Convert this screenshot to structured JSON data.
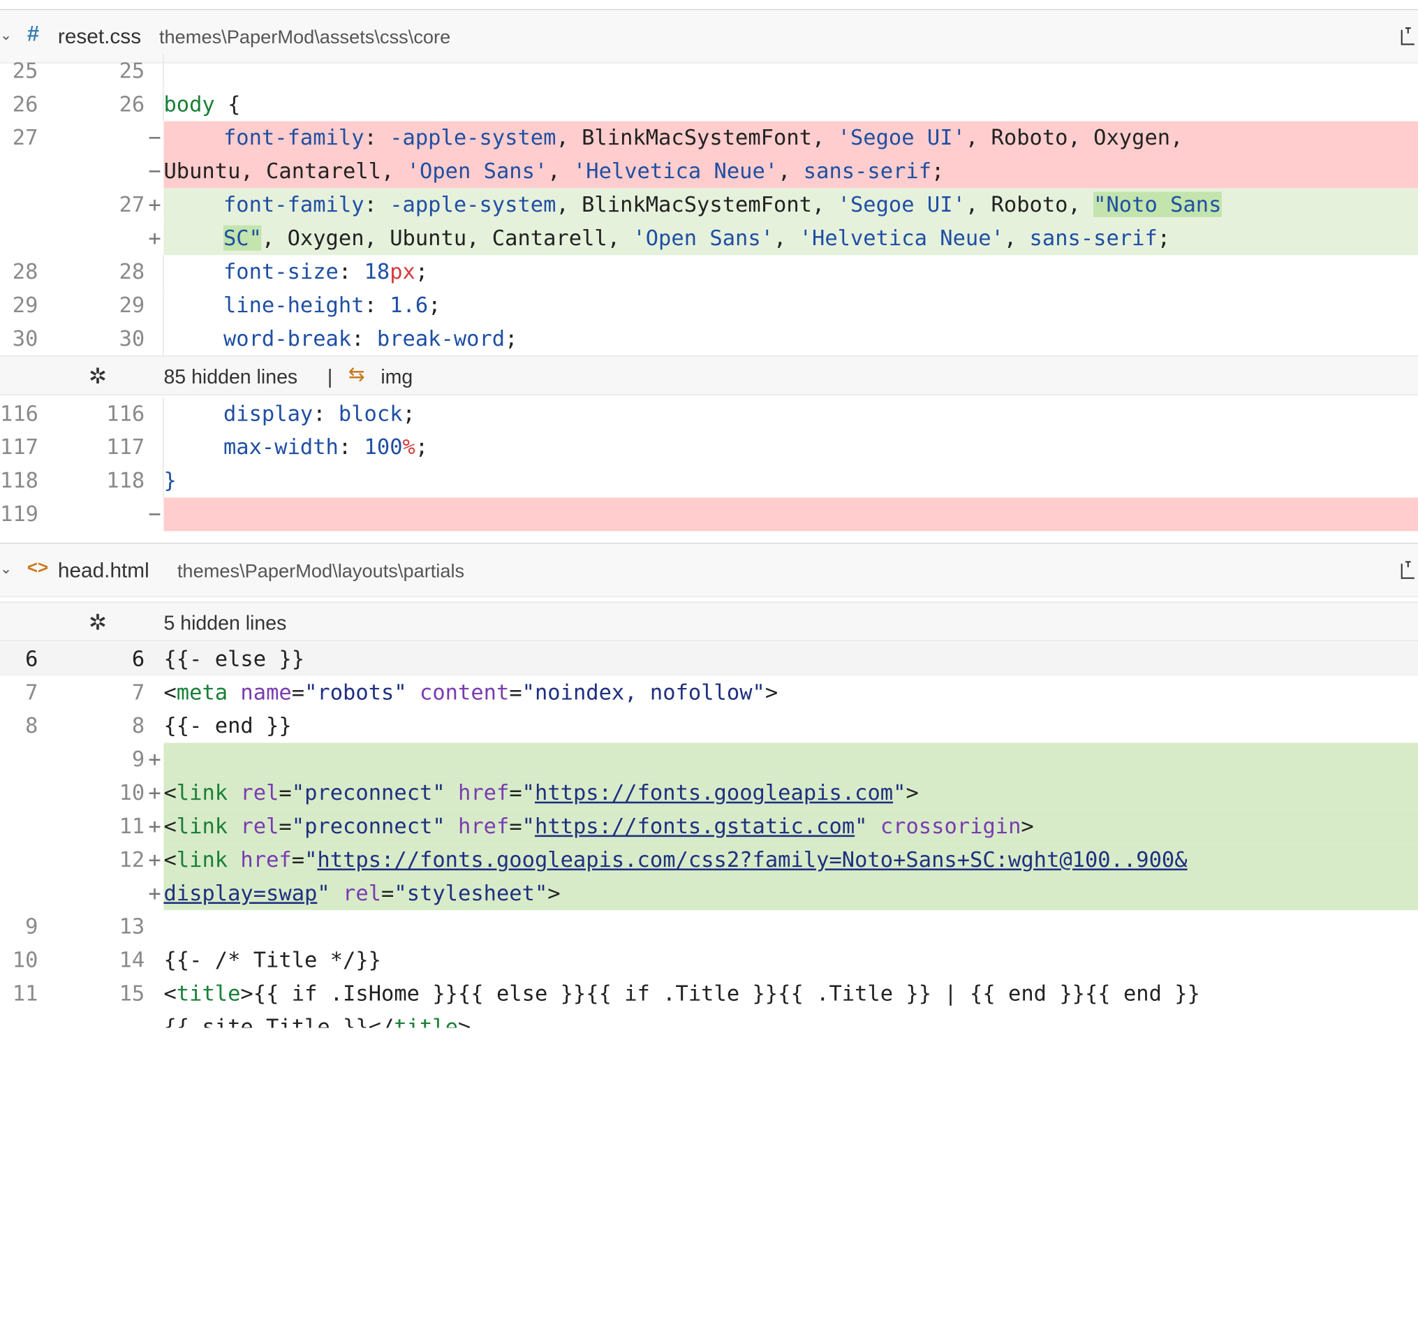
{
  "files": [
    {
      "icon": "#",
      "name": "reset.css",
      "path": "themes\\PaperMod\\assets\\css\\core"
    },
    {
      "icon": "<>",
      "name": "head.html",
      "path": "themes\\PaperMod\\layouts\\partials"
    }
  ],
  "reset": {
    "hidden1": {
      "label": "85 hidden lines",
      "sep": "|",
      "symbol": "img"
    },
    "lines": {
      "l25": {
        "old": "25",
        "new": "25"
      },
      "l26": {
        "old": "26",
        "new": "26"
      },
      "l27": {
        "old": "27",
        "new": "27"
      },
      "l28": {
        "old": "28",
        "new": "28"
      },
      "l29": {
        "old": "29",
        "new": "29"
      },
      "l30": {
        "old": "30",
        "new": "30"
      },
      "l116": {
        "old": "116",
        "new": "116"
      },
      "l117": {
        "old": "117",
        "new": "117"
      },
      "l118": {
        "old": "118",
        "new": "118"
      },
      "l119": {
        "old": "119"
      }
    }
  },
  "head": {
    "hidden": {
      "label": "5 hidden lines"
    },
    "nums": {
      "a": {
        "old": "6",
        "new": "6"
      },
      "b": {
        "old": "7",
        "new": "7"
      },
      "c": {
        "old": "8",
        "new": "8"
      },
      "d": {
        "new": "9"
      },
      "e": {
        "new": "10"
      },
      "f": {
        "new": "11"
      },
      "g": {
        "new": "12"
      },
      "h": {
        "old": "9",
        "new": "13"
      },
      "i": {
        "old": "10",
        "new": "14"
      },
      "j": {
        "old": "11",
        "new": "15"
      }
    }
  },
  "code": {
    "body": "body",
    "ob": " {",
    "ff": "font-family",
    "colon": ": ",
    "apple": "-apple-system",
    "rest1": ", BlinkMacSystemFont, ",
    "segoe": "'Segoe UI'",
    "rest2": ", Roboto, Oxygen,",
    "ubuntu": "Ubuntu, Cantarell, ",
    "opensans": "'Open Sans'",
    "comma": ", ",
    "helv": "'Helvetica Neue'",
    "sans": "sans-serif",
    "semi": ";",
    "roboto": ", Roboto, ",
    "noto1": "\"Noto Sans",
    "noto2": "SC\"",
    "rest3": ", Oxygen, Ubuntu, Cantarell, ",
    "fs": "font-size",
    "n18": "18",
    "px": "px",
    "lh": "line-height",
    "n16": "1.6",
    "wb": "word-break",
    "bw": "break-word",
    "disp": "display",
    "block": "block",
    "mw": "max-width",
    "n100": "100",
    "pct": "%",
    "cb": "}",
    "else": "{{- else }}",
    "lt": "<",
    "gt": ">",
    "meta": "meta",
    "name": "name",
    "eq": "=",
    "robots": "\"robots\"",
    "content": "content",
    "noindex": "\"noindex, nofollow\"",
    "end": "{{- end }}",
    "link": "link",
    "rel": "rel",
    "preconnect": "\"preconnect\"",
    "href": "href",
    "q": "\"",
    "gapis": "https://fonts.googleapis.com",
    "gstatic": "https://fonts.gstatic.com",
    "crossorigin": "crossorigin",
    "css2": "https://fonts.googleapis.com/css2?family=Noto+Sans+SC:wght@100..900&",
    "swap": "display=swap",
    "stylesheet": "\"stylesheet\"",
    "titlecomment": "{{- /* Title */}}",
    "title": "title",
    "titleexpr": "{{ if .IsHome }}{{ else }}{{ if .Title }}{{ .Title }} | {{ end }}{{ end }}",
    "sitetitle": "{{ site.Title }}</",
    "markdel": "−",
    "markadd": "+"
  }
}
